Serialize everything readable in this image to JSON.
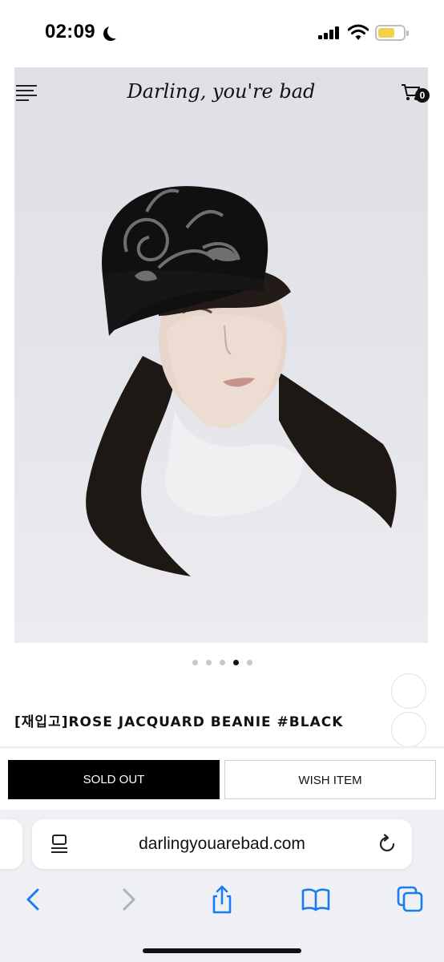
{
  "status_bar": {
    "time": "02:09"
  },
  "header": {
    "brand": "Darling, you're bad",
    "cart_count": "0"
  },
  "carousel": {
    "dot_count": 5,
    "active_index": 3
  },
  "product": {
    "title": "[재입고]ROSE JACQUARD BEANIE #BLACK"
  },
  "actions": {
    "sold_out_label": "SOLD OUT",
    "wish_label": "WISH ITEM"
  },
  "browser": {
    "url": "darlingyouarebad.com"
  },
  "colors": {
    "accent": "#000000",
    "battery": "#f2d24a",
    "safari_toolbar_icons": "#1a7cf0"
  }
}
